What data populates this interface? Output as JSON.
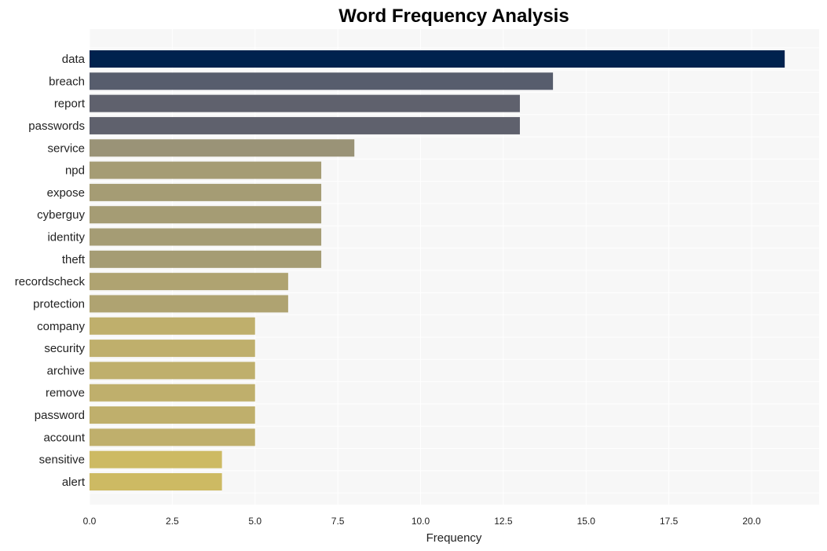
{
  "chart_data": {
    "type": "bar",
    "orientation": "horizontal",
    "title": "Word Frequency Analysis",
    "xlabel": "Frequency",
    "ylabel": "",
    "xlim": [
      0,
      22
    ],
    "xticks": [
      0.0,
      2.5,
      5.0,
      7.5,
      10.0,
      12.5,
      15.0,
      17.5,
      20.0
    ],
    "xtick_labels": [
      "0.0",
      "2.5",
      "5.0",
      "7.5",
      "10.0",
      "12.5",
      "15.0",
      "17.5",
      "20.0"
    ],
    "grid": true,
    "categories": [
      "data",
      "breach",
      "report",
      "passwords",
      "service",
      "npd",
      "expose",
      "cyberguy",
      "identity",
      "theft",
      "recordscheck",
      "protection",
      "company",
      "security",
      "archive",
      "remove",
      "password",
      "account",
      "sensitive",
      "alert"
    ],
    "values": [
      21,
      14,
      13,
      13,
      8,
      7,
      7,
      7,
      7,
      7,
      6,
      6,
      5,
      5,
      5,
      5,
      5,
      5,
      4,
      4
    ],
    "colors": [
      "#00224e",
      "#575d6d",
      "#5f616d",
      "#5f616d",
      "#9a9377",
      "#a59c74",
      "#a59c74",
      "#a59c74",
      "#a59c74",
      "#a59c74",
      "#afa371",
      "#afa371",
      "#bfaf6c",
      "#bfaf6c",
      "#bfaf6c",
      "#bfaf6c",
      "#bfaf6c",
      "#bfaf6c",
      "#cdba63",
      "#cdba63"
    ]
  },
  "colors": {
    "plot_background": "#f7f7f7",
    "grid": "#ffffff"
  }
}
